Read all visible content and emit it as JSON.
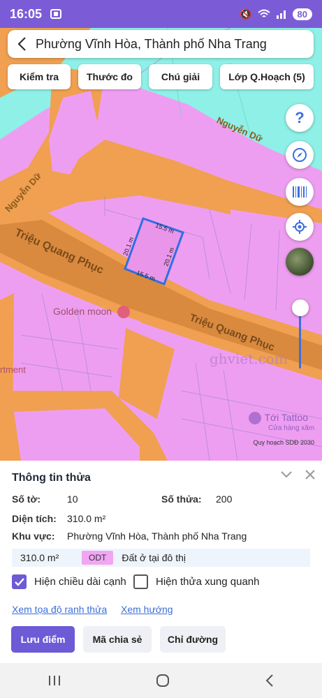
{
  "status": {
    "time": "16:05",
    "battery": "80"
  },
  "search": {
    "title": "Phường Vĩnh Hòa, Thành phố Nha Trang"
  },
  "toolbar": {
    "chips": [
      "Kiểm tra",
      "Thước đo",
      "Chú giải",
      "Lớp Q.Hoạch (5)"
    ]
  },
  "map": {
    "streets": {
      "nguyen_du_1": "Nguyễn Dữ",
      "nguyen_du_2": "Nguyễn Dữ",
      "trieu_qp_1": "Triệu Quang Phục",
      "trieu_qp_2": "Triệu Quang Phục"
    },
    "poi": {
      "golden_moon": "Golden moon",
      "apartment": "rtment",
      "toi_tattoo": "Tới Tattoo",
      "toi_tattoo_sub": "Cửa hàng xăm"
    },
    "watermark": "ghviet.com",
    "parcel": {
      "top": "15.5 m",
      "bottom": "15.5 m",
      "left": "20.1 m",
      "right": "20.1 m"
    },
    "credit": "Quy hoạch SDĐ 2030",
    "fab": {
      "help": "?"
    }
  },
  "info": {
    "title": "Thông tin thửa",
    "so_to_label": "Số tờ:",
    "so_to": "10",
    "so_thua_label": "Số thửa:",
    "so_thua": "200",
    "dien_tich_label": "Diện tích:",
    "dien_tich": "310.0 m²",
    "khu_vuc_label": "Khu vực:",
    "khu_vuc": "Phường Vĩnh Hòa, Thành phố Nha Trang",
    "zone": {
      "area": "310.0 m²",
      "code": "ODT",
      "desc": "Đất ở tại đô thị"
    },
    "checks": {
      "edges": "Hiện chiều dài cạnh",
      "neighbors": "Hiện thửa xung quanh"
    },
    "links": {
      "coords": "Xem tọa độ ranh thửa",
      "direction": "Xem hướng"
    },
    "buttons": {
      "save": "Lưu điểm",
      "share": "Mã chia sẻ",
      "route": "Chỉ đường"
    }
  },
  "colors": {
    "accent": "#6c5ad6",
    "road": "#f0a050",
    "land": "#ee9ef1",
    "water": "#8ef0e6",
    "parcel_border": "#2f6fe3"
  }
}
